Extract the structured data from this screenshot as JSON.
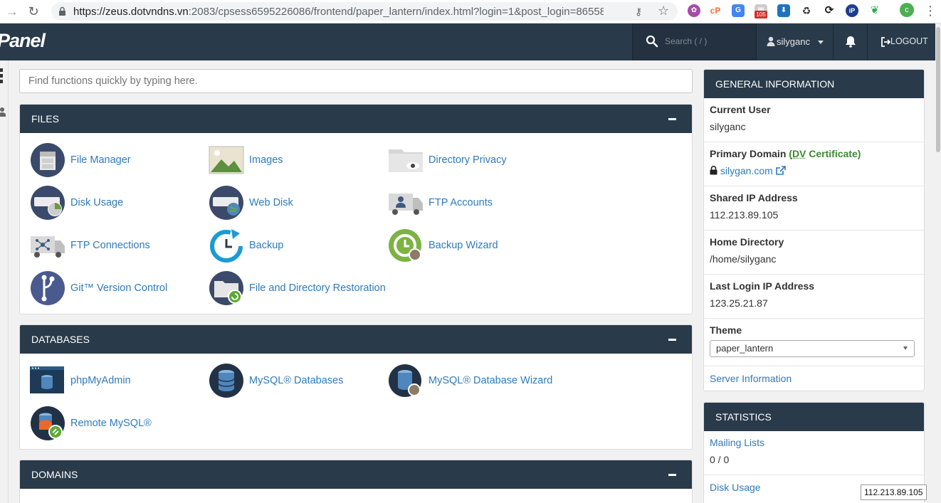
{
  "browser": {
    "url_host": "https://zeus.dotvndns.vn",
    "url_rest": ":2083/cpsess6595226086/frontend/paper_lantern/index.html?login=1&post_login=86558...",
    "ext_badge": "105",
    "profile_initial": "c"
  },
  "topnav": {
    "logo": "Panel",
    "search_placeholder": "Search ( / )",
    "user": "silyganc",
    "logout": "LOGOUT"
  },
  "quickfind": {
    "placeholder": "Find functions quickly by typing here."
  },
  "files": {
    "title": "FILES",
    "items": [
      {
        "label": "File Manager"
      },
      {
        "label": "Images"
      },
      {
        "label": "Directory Privacy"
      },
      {
        "label": "Disk Usage"
      },
      {
        "label": "Web Disk"
      },
      {
        "label": "FTP Accounts"
      },
      {
        "label": "FTP Connections"
      },
      {
        "label": "Backup"
      },
      {
        "label": "Backup Wizard"
      },
      {
        "label": "Git™ Version Control"
      },
      {
        "label": "File and Directory Restoration"
      }
    ]
  },
  "databases": {
    "title": "DATABASES",
    "items": [
      {
        "label": "phpMyAdmin"
      },
      {
        "label": "MySQL® Databases"
      },
      {
        "label": "MySQL® Database Wizard"
      },
      {
        "label": "Remote MySQL®"
      }
    ]
  },
  "domains": {
    "title": "DOMAINS"
  },
  "general": {
    "title": "GENERAL INFORMATION",
    "current_user_label": "Current User",
    "current_user": "silyganc",
    "primary_domain_label": "Primary Domain",
    "cert_open": "(",
    "cert_dv": "DV",
    "cert_rest": " Certificate)",
    "primary_domain": "silygan.com",
    "shared_ip_label": "Shared IP Address",
    "shared_ip": "112.213.89.105",
    "home_dir_label": "Home Directory",
    "home_dir": "/home/silyganc",
    "last_login_label": "Last Login IP Address",
    "last_login": "123.25.21.87",
    "theme_label": "Theme",
    "theme": "paper_lantern",
    "server_info": "Server Information"
  },
  "statistics": {
    "title": "STATISTICS",
    "mailing_lists_label": "Mailing Lists",
    "mailing_lists": "0 / 0",
    "disk_usage_label": "Disk Usage"
  },
  "tooltip": "112.213.89.105"
}
